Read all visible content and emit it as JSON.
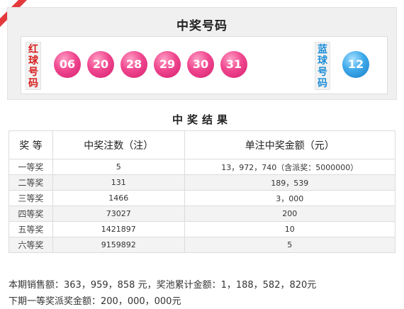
{
  "draw": {
    "title": "中奖号码",
    "red_label": [
      "红",
      "球",
      "号",
      "码"
    ],
    "blue_label": [
      "蓝",
      "球",
      "号",
      "码"
    ],
    "red_balls": [
      "06",
      "20",
      "28",
      "29",
      "30",
      "31"
    ],
    "blue_balls": [
      "12"
    ]
  },
  "results": {
    "title": "中奖结果",
    "headers": [
      "奖 等",
      "中奖注数（注）",
      "单注中奖金额（元）"
    ],
    "rows": [
      {
        "level": "一等奖",
        "count": "5",
        "amount": "13，972，740（含派奖：5000000）"
      },
      {
        "level": "二等奖",
        "count": "131",
        "amount": "189，539"
      },
      {
        "level": "三等奖",
        "count": "1466",
        "amount": "3，000"
      },
      {
        "level": "四等奖",
        "count": "73027",
        "amount": "200"
      },
      {
        "level": "五等奖",
        "count": "1421897",
        "amount": "10"
      },
      {
        "level": "六等奖",
        "count": "9159892",
        "amount": "5"
      }
    ]
  },
  "summary": {
    "line1": "本期销售额：363，959，858 元，奖池累计金额：1，188，582，820元",
    "line2": "下期一等奖派奖金额：200，000，000元"
  },
  "colors": {
    "accent": "#e4393c",
    "red_ball": "#f0478f",
    "blue_ball": "#3da9ea"
  }
}
